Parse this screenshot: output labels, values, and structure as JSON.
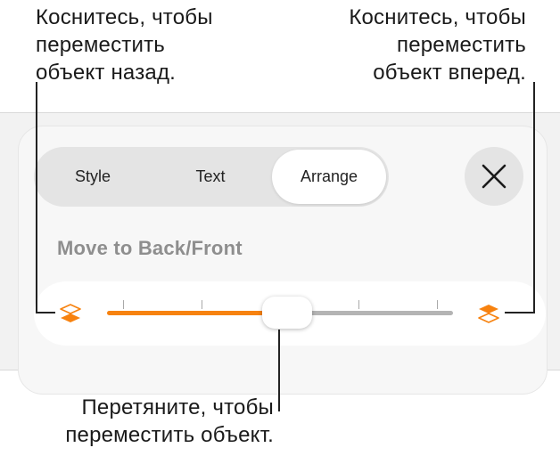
{
  "callouts": {
    "back": [
      "Коснитесь, чтобы",
      "переместить",
      "объект назад."
    ],
    "front": [
      "Коснитесь, чтобы",
      "переместить",
      "объект вперед."
    ],
    "drag": [
      "Перетяните, чтобы",
      "переместить объект."
    ]
  },
  "tabs": {
    "items": [
      {
        "label": "Style"
      },
      {
        "label": "Text"
      },
      {
        "label": "Arrange"
      }
    ],
    "active": "Arrange"
  },
  "close_button": {
    "icon": "close-icon"
  },
  "arrange": {
    "section_label": "Move to Back/Front",
    "slider": {
      "value": 0.52,
      "tick_count": 5,
      "left_icon": "move-to-back-icon",
      "right_icon": "move-to-front-icon"
    }
  },
  "colors": {
    "accent": "#f7820f",
    "track": "#b4b4b4",
    "panel_bg": "#f7f7f7",
    "screen_bg": "#f2f2f2",
    "segment_bg": "#e4e4e4"
  }
}
